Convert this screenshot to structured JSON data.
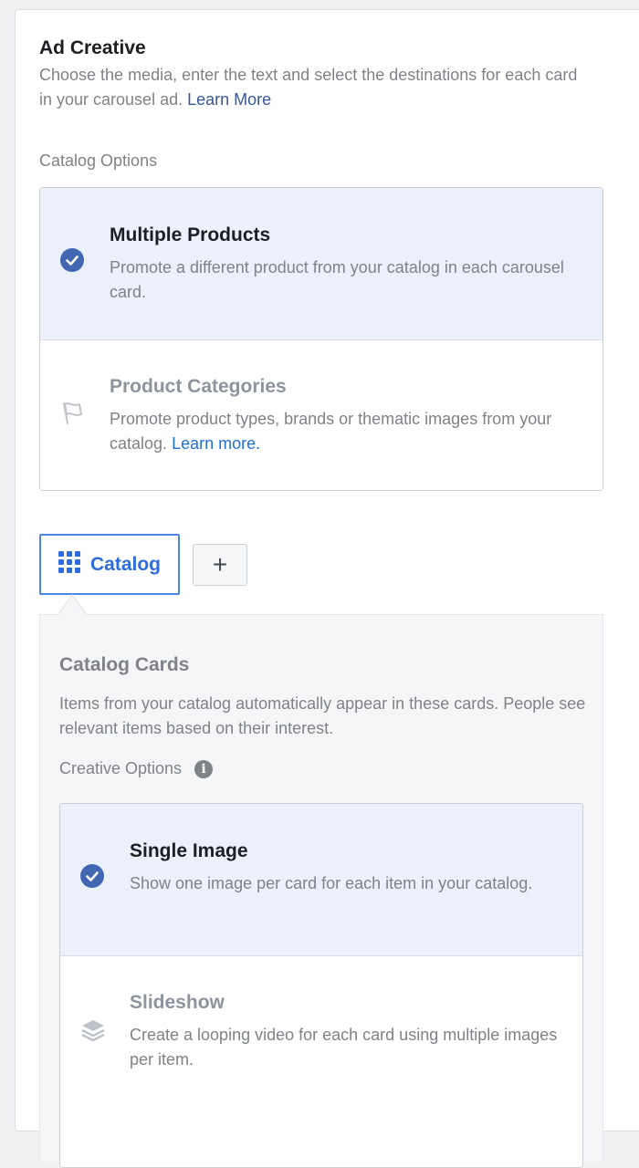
{
  "header": {
    "title": "Ad Creative",
    "description": "Choose the media, enter the text and select the destinations for each card in your carousel ad.",
    "learn_more": "Learn More"
  },
  "catalog_options": {
    "label": "Catalog Options",
    "options": [
      {
        "title": "Multiple Products",
        "description": "Promote a different product from your catalog in each carousel card.",
        "selected": true,
        "icon": "check-circle-icon"
      },
      {
        "title": "Product Categories",
        "description": "Promote product types, brands or thematic images from your catalog.",
        "link": "Learn more.",
        "selected": false,
        "icon": "flag-icon"
      }
    ]
  },
  "tabs": {
    "catalog_label": "Catalog",
    "catalog_icon": "grid-icon",
    "add_label": "+"
  },
  "catalog_cards": {
    "title": "Catalog Cards",
    "description": "Items from your catalog automatically appear in these cards. People see relevant items based on their interest.",
    "creative_options_label": "Creative Options",
    "info_icon": "i",
    "options": [
      {
        "title": "Single Image",
        "description": "Show one image per card for each item in your catalog.",
        "selected": true,
        "icon": "check-circle-icon"
      },
      {
        "title": "Slideshow",
        "description": "Create a looping video for each card using multiple images per item.",
        "selected": false,
        "icon": "layers-icon"
      }
    ]
  },
  "colors": {
    "accent": "#4267b2",
    "selected_bg": "#ebf0fb",
    "link": "#385898",
    "tab_border": "#4a86e8"
  }
}
